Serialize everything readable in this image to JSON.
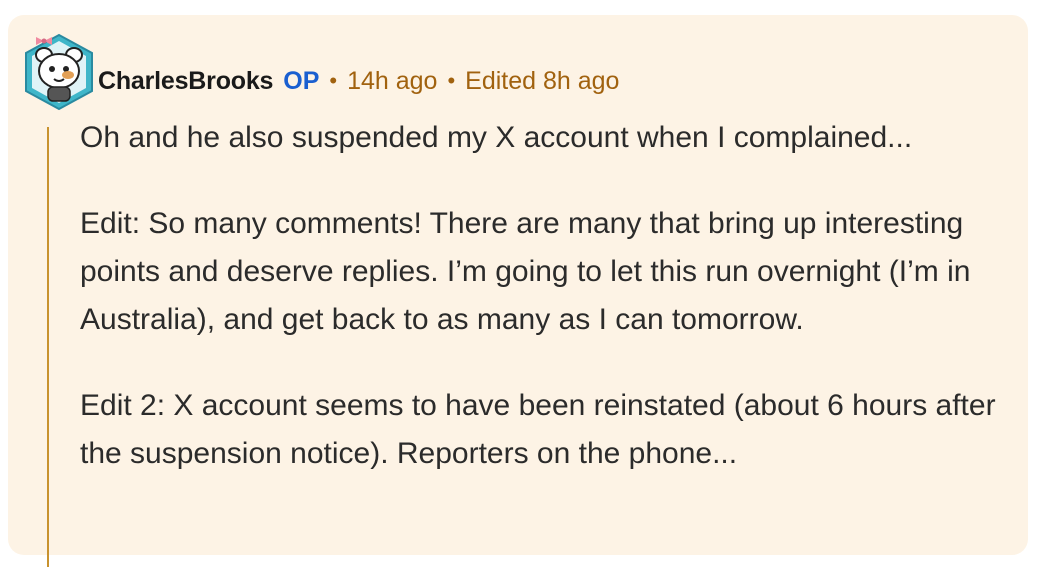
{
  "comment": {
    "author": "CharlesBrooks",
    "op_badge": "OP",
    "separator": "•",
    "timestamp": "14h ago",
    "edited": "Edited 8h ago",
    "paragraphs": [
      "Oh and he also suspended my X account when I complained...",
      "Edit: So many comments! There are many that bring up interesting points and deserve replies. I’m going to let this run overnight (I’m in Australia), and get back to as many as I can tomorrow.",
      "Edit 2: X account seems to have been reinstated (about 6 hours after the suspension notice). Reporters on the phone..."
    ]
  },
  "colors": {
    "card_background": "#fdf3e5",
    "thread_line": "#c8922e",
    "meta_text": "#a1620f",
    "op_badge": "#1a5fd0",
    "body_text": "#2b2b2b"
  },
  "icons": {
    "avatar": "snoo-avatar-icon"
  }
}
